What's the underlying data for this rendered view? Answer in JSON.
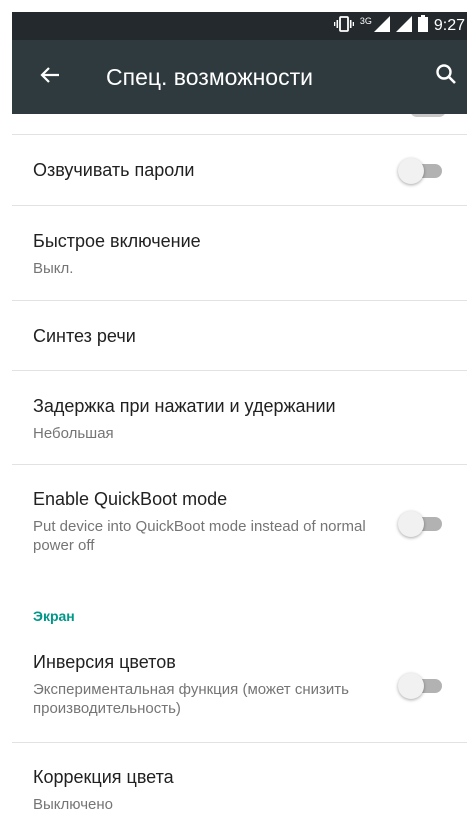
{
  "status_bar": {
    "time": "9:27",
    "network": "3G",
    "icons": [
      "vibrate-icon",
      "signal-3g-icon",
      "signal-icon",
      "battery-icon"
    ]
  },
  "toolbar": {
    "title": "Спец. возможности",
    "back_icon": "arrow-back-icon",
    "search_icon": "search-icon"
  },
  "items": [
    {
      "title": "Озвучивать пароли",
      "switch_on": false
    },
    {
      "title": "Быстрое включение",
      "subtitle": "Выкл."
    },
    {
      "title": "Синтез речи"
    },
    {
      "title": "Задержка при нажатии и удержании",
      "subtitle": "Небольшая"
    },
    {
      "title": "Enable QuickBoot mode",
      "subtitle": "Put device into QuickBoot mode instead of normal power off",
      "switch_on": false
    }
  ],
  "section_screen": {
    "label": "Экран",
    "items": [
      {
        "title": "Инверсия цветов",
        "subtitle": "Экспериментальная функция (может снизить производительность)",
        "switch_on": false
      },
      {
        "title": "Коррекция цвета",
        "subtitle": "Выключено"
      }
    ]
  },
  "colors": {
    "status_bar": "#23292d",
    "toolbar": "#2f3a3f",
    "accent": "#009688",
    "switch_track_off": "#b2b2b2",
    "switch_thumb_off": "#f1f1f1"
  }
}
